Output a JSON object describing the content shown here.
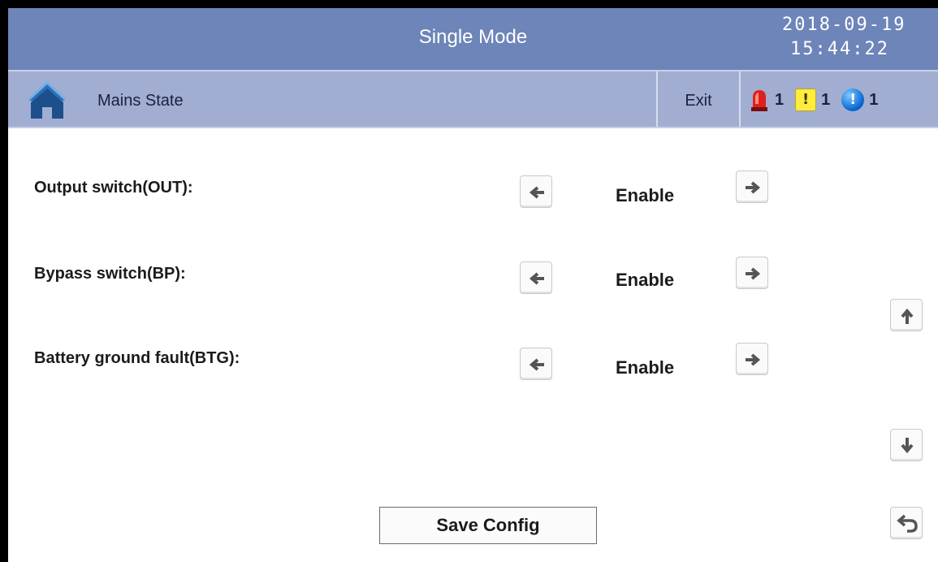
{
  "header": {
    "title": "Single Mode",
    "date": "2018-09-19",
    "time": "15:44:22"
  },
  "nav": {
    "home_icon": "home-icon",
    "page_label": "Mains State",
    "exit_label": "Exit",
    "alarms": [
      {
        "icon": "siren-alarm-icon",
        "count": "1",
        "color": "#e0201b"
      },
      {
        "icon": "warning-icon",
        "count": "1",
        "color": "#ffec3f"
      },
      {
        "icon": "info-icon",
        "count": "1",
        "color": "#0a6ad6"
      }
    ]
  },
  "settings": [
    {
      "label": "Output switch(OUT):",
      "value": "Enable"
    },
    {
      "label": "Bypass switch(BP):",
      "value": "Enable"
    },
    {
      "label": "Battery ground fault(BTG):",
      "value": "Enable"
    }
  ],
  "buttons": {
    "save_label": "Save Config",
    "scroll_up_icon": "arrow-up-icon",
    "scroll_down_icon": "arrow-down-icon",
    "back_icon": "return-icon"
  },
  "colors": {
    "title_bar": "#6d85b8",
    "nav_bar": "#a1aed2",
    "background": "#ffffff"
  }
}
